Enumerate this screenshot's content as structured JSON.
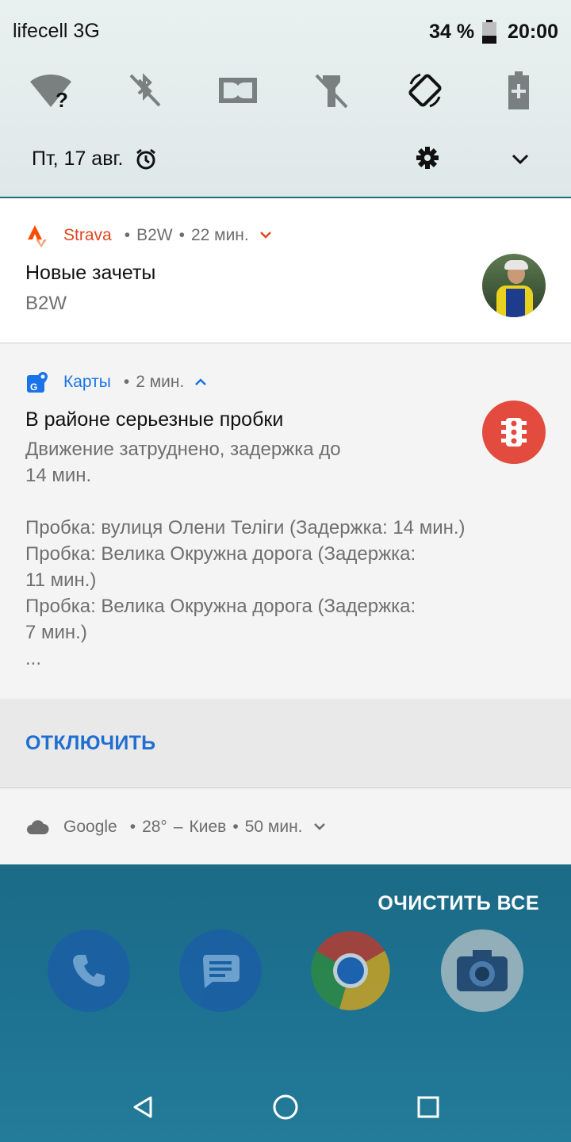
{
  "status_bar": {
    "carrier": "lifecell 3G",
    "battery_percent": "34 %",
    "time": "20:00"
  },
  "quick_settings": {
    "tiles": [
      "wifi-unknown-icon",
      "bluetooth-off-icon",
      "dolby-icon",
      "flashlight-off-icon",
      "auto-rotate-icon",
      "battery-saver-icon"
    ],
    "date": "Пт, 17 авг."
  },
  "notifications": {
    "strava": {
      "app": "Strava",
      "sub": "B2W",
      "time": "22 мин.",
      "title": "Новые зачеты",
      "text": "B2W",
      "accent": "#fc4c02"
    },
    "maps": {
      "app": "Карты",
      "time": "2 мин.",
      "title": "В районе серьезные пробки",
      "text_lines": [
        "Движение затруднено, задержка до",
        "14 мин.",
        "",
        "Пробка: вулиця Олени Теліги (Задержка: 14 мин.)",
        "Пробка: Велика Окружна дорога (Задержка:",
        "11 мин.)",
        "Пробка: Велика Окружна дорога (Задержка:",
        "7 мин.)",
        "..."
      ],
      "action": "ОТКЛЮЧИТЬ",
      "accent": "#1a73e8",
      "badge_color": "#e24b3d"
    },
    "google": {
      "app": "Google",
      "temp": "28°",
      "city": "Киев",
      "time": "50 мин."
    }
  },
  "clear_all": "ОЧИСТИТЬ ВСЕ",
  "dock": [
    "phone-icon",
    "messages-icon",
    "chrome-icon",
    "camera-icon"
  ],
  "nav": [
    "back-icon",
    "home-icon",
    "recents-icon"
  ]
}
